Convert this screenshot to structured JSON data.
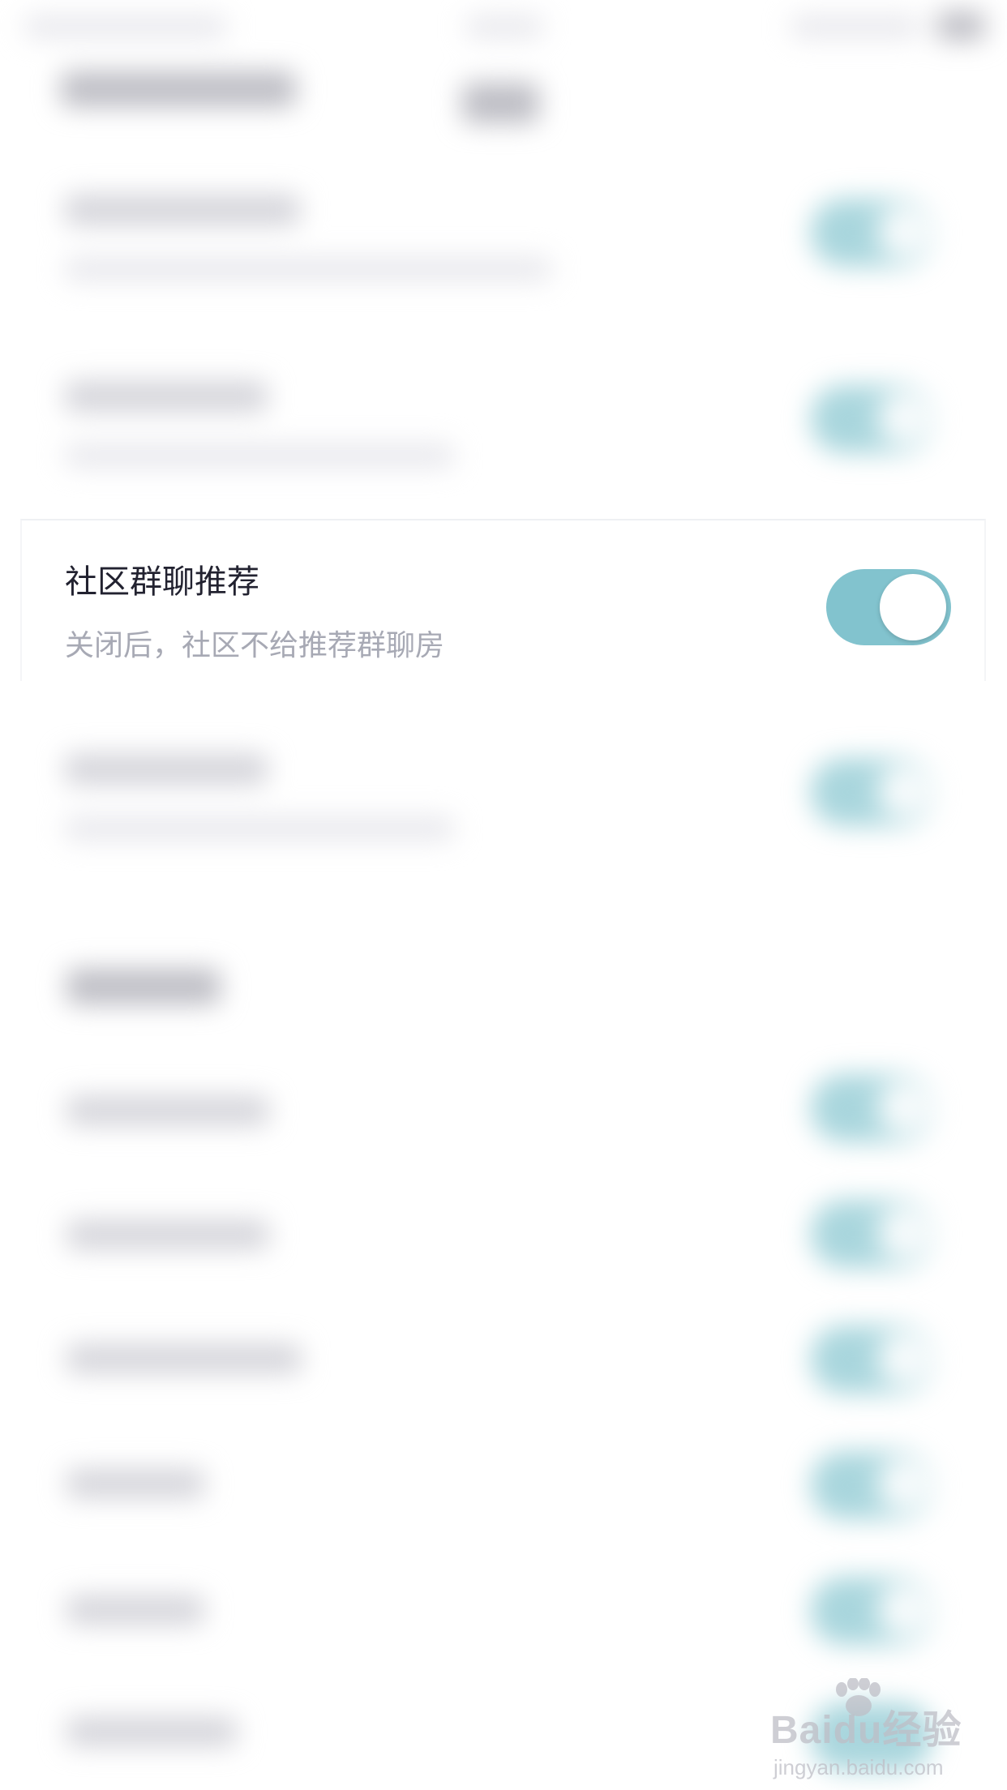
{
  "setting": {
    "title": "社区群聊推荐",
    "description": "关闭后，社区不给推荐群聊房",
    "toggle_on": true
  },
  "colors": {
    "toggle_track": "#82c3ce",
    "toggle_knob": "#ffffff",
    "title_text": "#222230",
    "description_text": "#a7a9b4",
    "background": "#ffffff"
  },
  "watermark": {
    "main": "Baidu经验",
    "sub": "jingyan.baidu.com"
  }
}
